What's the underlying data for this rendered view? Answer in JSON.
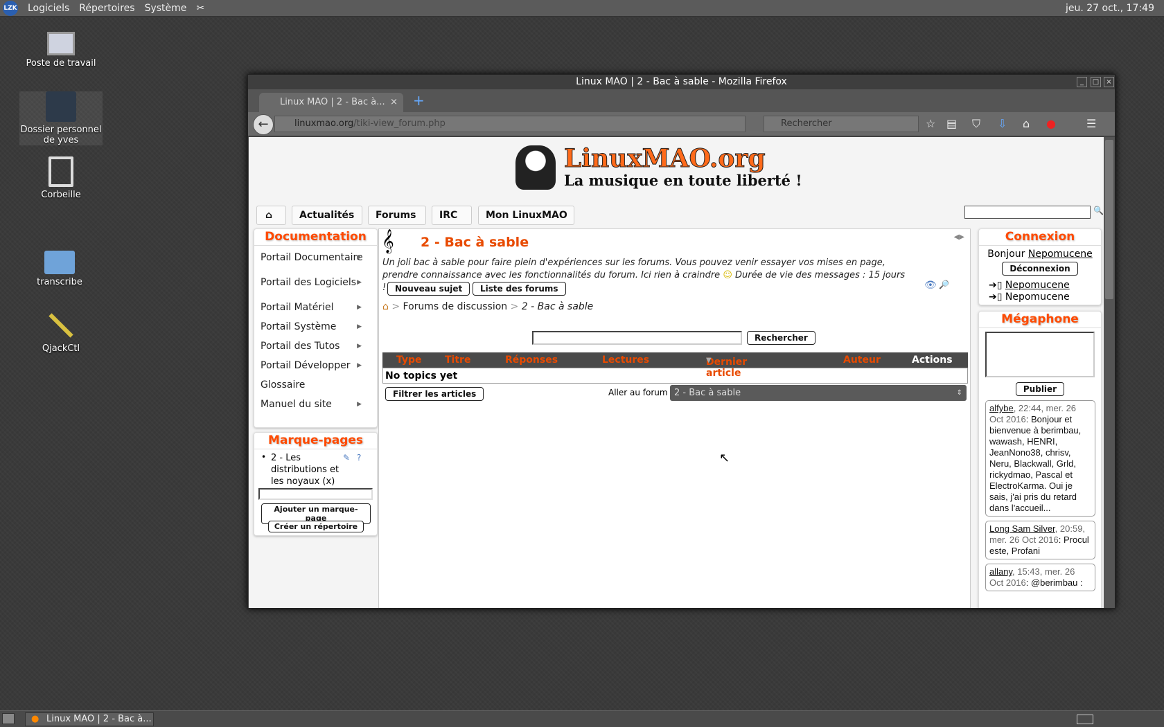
{
  "panel": {
    "logo": "LZK",
    "menus": [
      "Logiciels",
      "Répertoires",
      "Système"
    ],
    "clock": "jeu. 27 oct., 17:49"
  },
  "desktop": [
    "Poste de travail",
    "Dossier personnel de yves",
    "Corbeille",
    "transcribe",
    "QjackCtl"
  ],
  "window": {
    "title": "Linux MAO | 2 - Bac à sable - Mozilla Firefox",
    "tab": "Linux MAO | 2 - Bac à...",
    "url_host": "linuxmao.org",
    "url_path": "/tiki-view_forum.php",
    "search_placeholder": "Rechercher"
  },
  "site": {
    "logo_title": "LinuxMAO.org",
    "logo_subtitle": "La musique en toute liberté !",
    "nav": [
      "Actualités",
      "Forums",
      "IRC",
      "Mon LinuxMAO"
    ]
  },
  "doc": {
    "title": "Documentation",
    "items": [
      "Portail Documentaire",
      "Portail des Logiciels",
      "Portail Matériel",
      "Portail Système",
      "Portail des Tutos",
      "Portail Développer",
      "Glossaire",
      "Manuel du site"
    ]
  },
  "bookmarks": {
    "title": "Marque-pages",
    "item": "2 - Les distributions et les noyaux (x)",
    "add": "Ajouter un marque-page",
    "mkdir": "Créer un répertoire"
  },
  "forum": {
    "title": "2 - Bac à sable",
    "description": "Un joli bac à sable pour faire plein d'expériences sur les forums. Vous pouvez venir essayer vos mises en page, prendre connaissance avec les fonctionnalités du forum. Ici rien à craindre",
    "description2": "Durée de vie des messages : 15 jours !",
    "new_topic": "Nouveau sujet",
    "list_forums": "Liste des forums",
    "crumb_forums": "Forums de discussion",
    "crumb_sep": ">",
    "crumb_current": "2 - Bac à sable",
    "search_button": "Rechercher",
    "columns": [
      "Type",
      "Titre",
      "Réponses",
      "Lectures",
      "Dernier article",
      "Auteur",
      "Actions"
    ],
    "empty": "No topics yet",
    "filter": "Filtrer les articles",
    "goto_label": "Aller au forum :",
    "goto_value": "2 - Bac à sable"
  },
  "login": {
    "title": "Connexion",
    "hello": "Bonjour",
    "user": "Nepomucene",
    "logout": "Déconnexion",
    "links": [
      "Nepomucene",
      "Nepomucene"
    ]
  },
  "megaphone": {
    "title": "Mégaphone",
    "publish": "Publier",
    "messages": [
      {
        "author": "alfybe",
        "date": ", 22:44, mer. 26 Oct 2016",
        "text": ": Bonjour et bienvenue à berimbau, wawash, HENRI, JeanNono38, chrisv, Neru, Blackwall, Grld, rickydmao, Pascal et ElectroKarma. Oui je sais, j'ai pris du retard dans l'accueil..."
      },
      {
        "author": "Long Sam Silver",
        "date": ", 20:59, mer. 26 Oct 2016",
        "text": ": Procul este, Profani"
      },
      {
        "author": "allany",
        "date": ", 15:43, mer. 26 Oct 2016",
        "text": ": @berimbau :"
      }
    ]
  },
  "taskbar": {
    "task": "Linux MAO | 2 - Bac à..."
  }
}
